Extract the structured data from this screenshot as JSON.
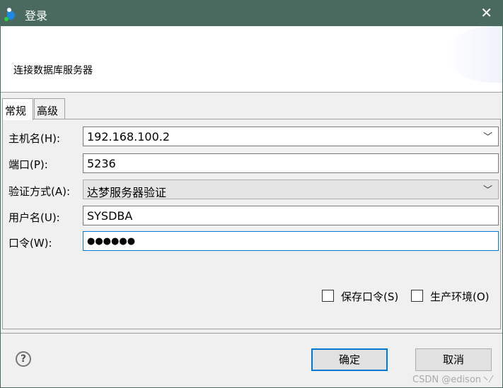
{
  "window": {
    "title": "登录",
    "close": "✕"
  },
  "banner": {
    "message": "连接数据库服务器"
  },
  "tabs": [
    {
      "label": "常规"
    },
    {
      "label": "高级"
    }
  ],
  "form": {
    "host": {
      "label": "主机名(H):",
      "value": "192.168.100.2"
    },
    "port": {
      "label": "端口(P):",
      "value": "5236"
    },
    "auth": {
      "label": "验证方式(A):",
      "value": "达梦服务器验证"
    },
    "user": {
      "label": "用户名(U):",
      "value": "SYSDBA"
    },
    "password": {
      "label": "口令(W):",
      "value": "●●●●●●"
    },
    "save_password": {
      "label": "保存口令(S)",
      "checked": false
    },
    "production": {
      "label": "生产环境(O)",
      "checked": false
    }
  },
  "footer": {
    "help": "?",
    "ok": "确定",
    "cancel": "取消",
    "watermark": "CSDN @edison丶⁄"
  }
}
